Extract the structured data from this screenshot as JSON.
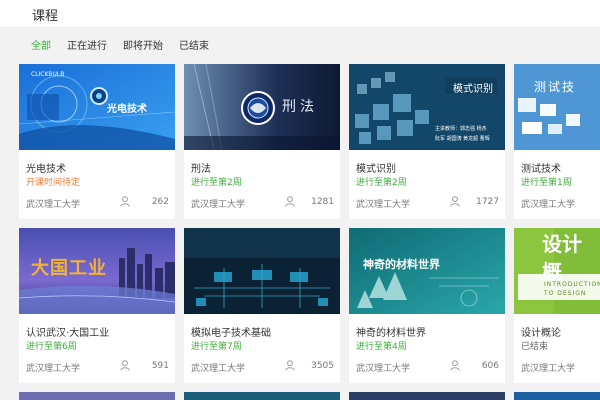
{
  "header": {
    "title": "课程"
  },
  "filters": [
    {
      "label": "全部",
      "active": true
    },
    {
      "label": "正在进行",
      "active": false
    },
    {
      "label": "即将开始",
      "active": false
    },
    {
      "label": "已结束",
      "active": false
    }
  ],
  "courses": [
    {
      "name": "光电技术",
      "status": "开课时间待定",
      "status_color": "#f07e3c",
      "school": "武汉理工大学",
      "students": "262",
      "thumb_text": "光电技术",
      "thumb_icon": "optics-lens-icon"
    },
    {
      "name": "刑法",
      "status": "进行至第2周",
      "status_color": "#3dac3d",
      "school": "武汉理工大学",
      "students": "1281",
      "thumb_text": "刑法",
      "thumb_icon": "university-emblem-icon"
    },
    {
      "name": "模式识别",
      "status": "进行至第2周",
      "status_color": "#3dac3d",
      "school": "武汉理工大学",
      "students": "1727",
      "thumb_text": "模式识别",
      "thumb_subtext": "主讲教师：郭志强  杨杰",
      "thumb_subtext2": "阮军  胡国涛  黄龙超  曹辉",
      "thumb_icon": "cube-grid-icon"
    },
    {
      "name": "测试技术",
      "status": "进行至第1周",
      "status_color": "#3dac3d",
      "school": "武汉理工大学",
      "students": "",
      "thumb_text": "测试技",
      "thumb_icon": "circuit-icon"
    },
    {
      "name": "认识武汉·大国工业",
      "status": "进行至第6周",
      "status_color": "#3dac3d",
      "school": "武汉理工大学",
      "students": "591",
      "thumb_text": "大国工业",
      "thumb_icon": "city-skyline-icon"
    },
    {
      "name": "模拟电子技术基础",
      "status": "进行至第7周",
      "status_color": "#3dac3d",
      "school": "武汉理工大学",
      "students": "3505",
      "thumb_icon": "circuit-board-icon"
    },
    {
      "name": "神奇的材料世界",
      "status": "进行至第4周",
      "status_color": "#3dac3d",
      "school": "武汉理工大学",
      "students": "606",
      "thumb_text": "神奇的材料世界",
      "thumb_icon": "crystal-icon"
    },
    {
      "name": "设计概论",
      "status": "已结束",
      "status_color": "#666666",
      "school": "武汉理工大学",
      "students": "",
      "thumb_text": "设计概",
      "thumb_subtext": "INTRODUCTION TO DESIGN",
      "thumb_icon": "design-icon"
    }
  ]
}
